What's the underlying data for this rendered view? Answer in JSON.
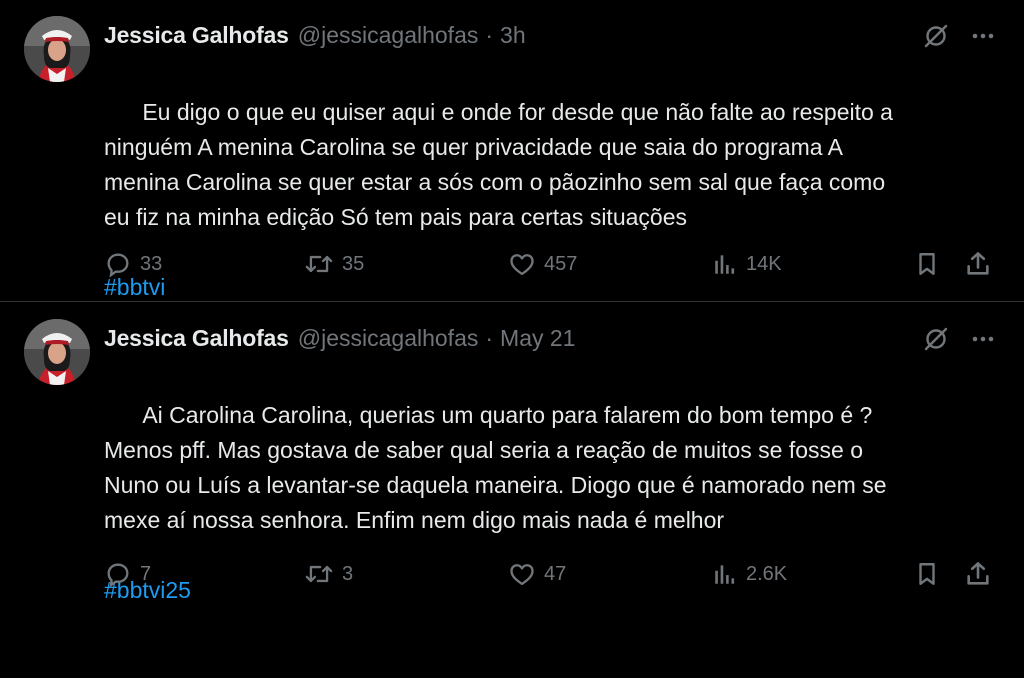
{
  "tweets": [
    {
      "author_name": "Jessica Galhofas",
      "handle": "@jessicagalhofas",
      "separator": "·",
      "time": "3h",
      "text": "Eu digo o que eu quiser aqui e onde for desde que não falte ao respeito a\nninguém A menina Carolina se quer privacidade que saia do programa A\nmenina Carolina se quer estar a sós com o pãozinho sem sal que faça como\neu fiz na minha edição Só tem pais para certas situações",
      "hashtag": "#bbtvi",
      "replies": "33",
      "reposts": "35",
      "likes": "457",
      "views": "14K"
    },
    {
      "author_name": "Jessica Galhofas",
      "handle": "@jessicagalhofas",
      "separator": "·",
      "time": "May 21",
      "text": "Ai Carolina Carolina, querias um quarto para falarem do bom tempo é ?\nMenos pff. Mas gostava de saber qual seria a reação de muitos se fosse o\nNuno ou Luís a levantar-se daquela maneira. Diogo que é namorado nem se\nmexe aí nossa senhora. Enfim nem digo mais nada é melhor",
      "hashtag": "#bbtvi25",
      "replies": "7",
      "reposts": "3",
      "likes": "47",
      "views": "2.6K"
    }
  ],
  "colors": {
    "background": "#000000",
    "text": "#e7e9ea",
    "muted": "#71767b",
    "link": "#1d9bf0",
    "divider": "#2f3336"
  },
  "icons": [
    "grok-icon",
    "more-icon",
    "reply-icon",
    "repost-icon",
    "like-icon",
    "views-icon",
    "bookmark-icon",
    "share-icon"
  ]
}
